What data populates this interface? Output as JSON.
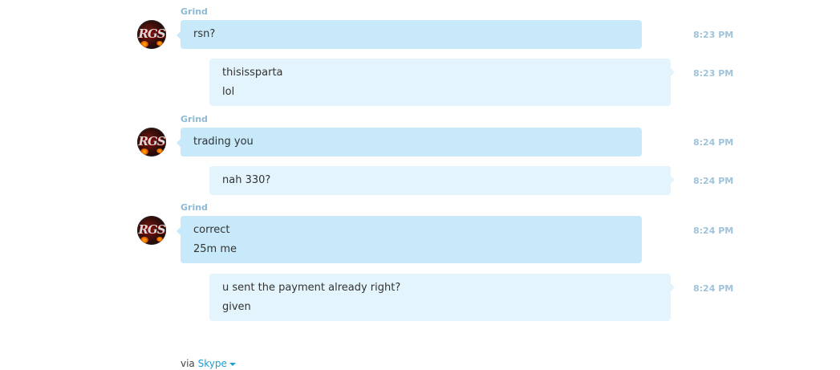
{
  "conversation": [
    {
      "sender": "Grind",
      "direction": "in",
      "time": "8:23 PM",
      "lines": [
        "rsn?"
      ]
    },
    {
      "direction": "out",
      "time": "8:23 PM",
      "lines": [
        "thisissparta",
        "lol"
      ]
    },
    {
      "sender": "Grind",
      "direction": "in",
      "time": "8:24 PM",
      "lines": [
        "trading you"
      ]
    },
    {
      "direction": "out",
      "time": "8:24 PM",
      "lines": [
        "nah 330?"
      ]
    },
    {
      "sender": "Grind",
      "direction": "in",
      "time": "8:24 PM",
      "lines": [
        "correct",
        "25m me"
      ]
    },
    {
      "direction": "out",
      "time": "8:24 PM",
      "lines": [
        "u sent the payment already right?",
        "given"
      ]
    }
  ],
  "avatar": {
    "logo_text": "RGS"
  },
  "footer": {
    "via_label": "via",
    "service_link": "Skype"
  },
  "colors": {
    "incoming_bubble": "#c7e9f9",
    "outgoing_bubble": "#e3f4fc",
    "sender_name": "#8fb9d3",
    "timestamp": "#9fc3d9",
    "link": "#1c9fd6"
  }
}
